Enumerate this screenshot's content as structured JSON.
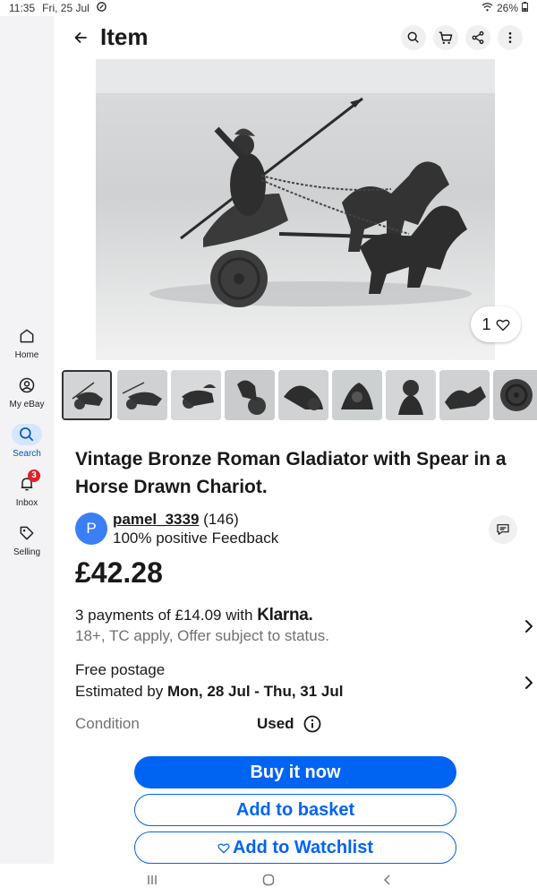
{
  "status": {
    "time": "11:35",
    "date": "Fri, 25 Jul",
    "battery": "26%"
  },
  "header": {
    "title": "Item"
  },
  "sidebar": {
    "items": [
      {
        "label": "Home",
        "icon": "home-icon"
      },
      {
        "label": "My eBay",
        "icon": "user-icon"
      },
      {
        "label": "Search",
        "icon": "search-icon",
        "active": true
      },
      {
        "label": "Inbox",
        "icon": "bell-icon",
        "badge": "3"
      },
      {
        "label": "Selling",
        "icon": "tag-icon"
      }
    ]
  },
  "gallery": {
    "watch_count": "1",
    "thumbnail_count": 9
  },
  "item": {
    "title": "Vintage Bronze Roman Gladiator with Spear in a Horse Drawn Chariot.",
    "price": "£42.28"
  },
  "seller": {
    "initial": "P",
    "username": "pamel_3339",
    "score": "(146)",
    "feedback": "100% positive Feedback"
  },
  "payments": {
    "text": "3 payments of £14.09 with",
    "brand": "Klarna.",
    "note": "18+, TC apply, Offer subject to status."
  },
  "postage": {
    "label": "Free postage",
    "estimated_prefix": "Estimated by",
    "estimated_dates": "Mon, 28 Jul - Thu, 31 Jul"
  },
  "condition": {
    "label": "Condition",
    "value": "Used"
  },
  "actions": {
    "buy": "Buy it now",
    "basket": "Add to basket",
    "watchlist": "Add to Watchlist"
  },
  "colors": {
    "accent": "#0064f2",
    "badge": "#e0202a"
  }
}
